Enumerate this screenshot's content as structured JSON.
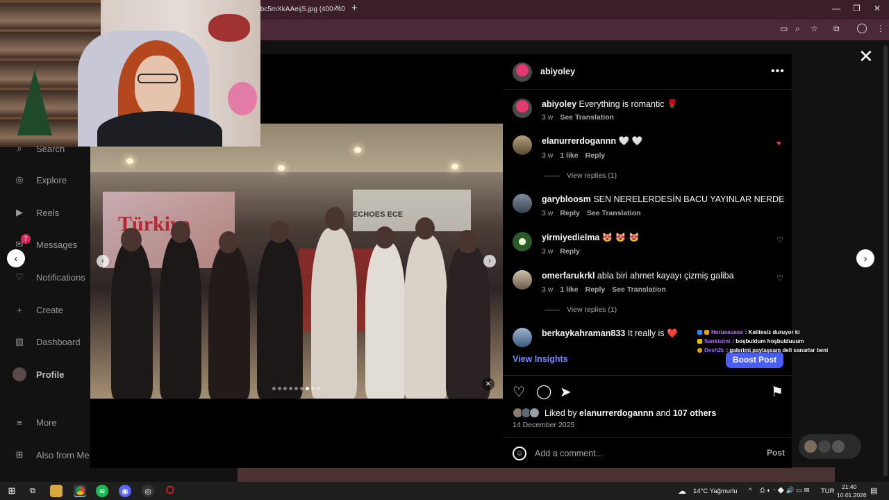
{
  "browser": {
    "tab_title": "Vbc5mXkAAeijS.jpg (400×40",
    "tab_close": "×",
    "new_tab": "+",
    "minimize": "—",
    "restore": "❐",
    "close": "✕"
  },
  "sidebar": {
    "items": [
      {
        "label": "Search",
        "icon": "search-icon"
      },
      {
        "label": "Explore",
        "icon": "compass-icon"
      },
      {
        "label": "Reels",
        "icon": "reels-icon"
      },
      {
        "label": "Messages",
        "icon": "messages-icon",
        "badge": "7"
      },
      {
        "label": "Notifications",
        "icon": "heart-icon"
      },
      {
        "label": "Create",
        "icon": "plus-icon"
      },
      {
        "label": "Dashboard",
        "icon": "dashboard-icon"
      },
      {
        "label": "Profile",
        "icon": "avatar"
      },
      {
        "label": "More",
        "icon": "menu-icon"
      },
      {
        "label": "Also from Me",
        "icon": "apps-icon"
      }
    ]
  },
  "media": {
    "screen_title": "Türkiye",
    "banner_text": "ECHOES     ECE"
  },
  "post": {
    "author": "abiyoley",
    "more": "•••",
    "caption": {
      "user": "abiyoley",
      "text": "Everything is romantic 🌹",
      "time": "3 w",
      "translate": "See Translation"
    },
    "comments": [
      {
        "user": "elanurrerdogannn",
        "text": "🤍 🤍",
        "time": "3 w",
        "likes": "1 like",
        "reply": "Reply",
        "liked": true,
        "view_replies": "View replies (1)"
      },
      {
        "user": "garybloosm",
        "text": "SEN NERELERDESİN BACU YAYINLAR NERDE",
        "time": "3 w",
        "reply": "Reply",
        "translate": "See Translation"
      },
      {
        "user": "yirmiyedielma",
        "text": "😻 😻 😻",
        "time": "3 w",
        "reply": "Reply"
      },
      {
        "user": "omerfarukrkl",
        "text": "abla biri ahmet kayayı çizmiş galiba",
        "time": "3 w",
        "likes": "1 like",
        "reply": "Reply",
        "translate": "See Translation",
        "view_replies": "View replies (1)"
      },
      {
        "user": "berkaykahraman833",
        "text": "It really is ❤️"
      }
    ],
    "view_insights": "View Insights",
    "boost": "Boost Post",
    "liked_by_prefix": "Liked by",
    "liked_by_user": "elanurrerdogannn",
    "liked_by_and": "and",
    "liked_by_others": "107 others",
    "date": "14 December 2025",
    "comment_placeholder": "Add a comment...",
    "post_button": "Post"
  },
  "stream_chat": [
    {
      "name": "Horuseusss",
      "msg": ": Kalitesiz duruyor ki",
      "color": "#c77dff",
      "badges": "⚄ 🎖"
    },
    {
      "name": "Sankisimi",
      "msg": ": boşbuldum hoşbulduuum",
      "color": "#b36bff",
      "badges": "🟨"
    },
    {
      "name": "Desh2k",
      "msg": ": galerimi paylaşsam deli sanarlar beni",
      "color": "#9d6bff",
      "badges": "🟡"
    }
  ],
  "taskbar": {
    "weather": "14°C  Yağmurlu",
    "lang": "TUR",
    "time": "21:40",
    "date": "10.01.2026"
  },
  "colors": {
    "accent_blue": "#4a5df9",
    "link_blue": "#6e8cff",
    "like_red": "#ff3040",
    "tabbar": "#3a1f2a"
  }
}
